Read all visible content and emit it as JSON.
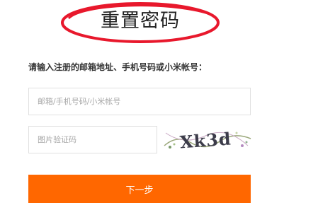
{
  "title": "重置密码",
  "instruction": "请输入注册的邮箱地址、手机号码或小米帐号：",
  "form": {
    "account_placeholder": "邮箱/手机号码/小米帐号",
    "captcha_placeholder": "图片验证码",
    "captcha_text": "Xk3d",
    "next_label": "下一步"
  },
  "colors": {
    "accent": "#ff6700",
    "annotation_circle": "#e8182c"
  }
}
